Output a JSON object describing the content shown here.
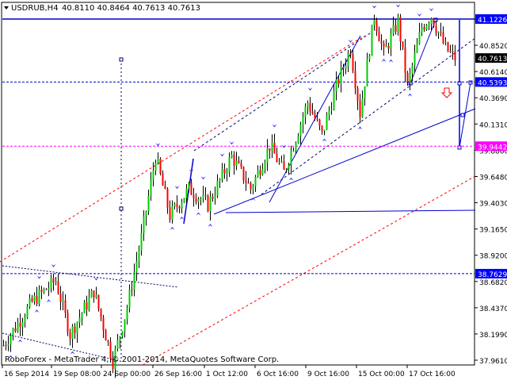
{
  "header": {
    "symbol_label": "USDRUB,H4",
    "ohlc_label": "40.8110 40.8464 40.7613 40.7613"
  },
  "footer": {
    "copyright": "RoboForex - MetaTrader 4, © 2001-2014, MetaQuotes Software Corp."
  },
  "colors": {
    "background": "#ffffff",
    "bull_candle": "#00cc00",
    "bear_candle": "#ff0000",
    "wick": "#000000",
    "channel_red": "#ff0000",
    "trend_blue": "#0000cc",
    "fractal_blue": "#3333ff",
    "level_magenta": "#ff00ff",
    "label_bg": "#000000",
    "label_blue_bg": "#0000ff"
  },
  "chart_data": {
    "type": "candlestick",
    "title": "USDRUB,H4",
    "ylim": [
      37.82,
      41.4
    ],
    "y_ticks": [
      "41.1226",
      "40.8520",
      "40.6140",
      "40.3690",
      "40.1310",
      "39.8860",
      "39.6480",
      "39.4030",
      "39.1650",
      "38.9200",
      "38.6820",
      "38.4370",
      "38.1990",
      "37.9610"
    ],
    "x_ticks": [
      "16 Sep 2014",
      "19 Sep 08:00",
      "24 Sep 00:00",
      "26 Sep 16:00",
      "1 Oct 12:00",
      "6 Oct 16:00",
      "9 Oct 16:00",
      "15 Oct 00:00",
      "17 Oct 16:00"
    ],
    "levels": [
      {
        "price": 41.1226,
        "label": "41.1226",
        "style": "solid",
        "color": "#0000cc"
      },
      {
        "price": 40.5393,
        "label": "40.5393",
        "style": "dashed",
        "color": "#0000cc"
      },
      {
        "price": 39.9442,
        "label": "39.9442",
        "style": "dashed",
        "color": "#ff00ff"
      },
      {
        "price": 38.7629,
        "label": "38.7629",
        "style": "dashed",
        "color": "#0000cc"
      }
    ],
    "current_price": {
      "price": 40.7613,
      "label": "40.7613"
    },
    "waypoints": [
      {
        "t": 0,
        "p": 38.1
      },
      {
        "t": 12,
        "p": 38.5
      },
      {
        "t": 22,
        "p": 38.7
      },
      {
        "t": 28,
        "p": 38.2
      },
      {
        "t": 38,
        "p": 38.6
      },
      {
        "t": 46,
        "p": 37.95
      },
      {
        "t": 52,
        "p": 38.45
      },
      {
        "t": 58,
        "p": 39.1
      },
      {
        "t": 64,
        "p": 39.85
      },
      {
        "t": 70,
        "p": 39.3
      },
      {
        "t": 78,
        "p": 39.55
      },
      {
        "t": 86,
        "p": 39.4
      },
      {
        "t": 96,
        "p": 39.85
      },
      {
        "t": 104,
        "p": 39.55
      },
      {
        "t": 112,
        "p": 39.95
      },
      {
        "t": 118,
        "p": 39.7
      },
      {
        "t": 128,
        "p": 40.35
      },
      {
        "t": 134,
        "p": 40.05
      },
      {
        "t": 140,
        "p": 40.5
      },
      {
        "t": 146,
        "p": 40.85
      },
      {
        "t": 150,
        "p": 40.25
      },
      {
        "t": 156,
        "p": 41.15
      },
      {
        "t": 160,
        "p": 40.8
      },
      {
        "t": 166,
        "p": 41.1
      },
      {
        "t": 170,
        "p": 40.5
      },
      {
        "t": 176,
        "p": 41.05
      },
      {
        "t": 180,
        "p": 41.15
      },
      {
        "t": 186,
        "p": 40.85
      },
      {
        "t": 190,
        "p": 40.76
      }
    ],
    "candle_count": 191,
    "candle_step": 3.0,
    "candle_origin_x": 4.5
  }
}
